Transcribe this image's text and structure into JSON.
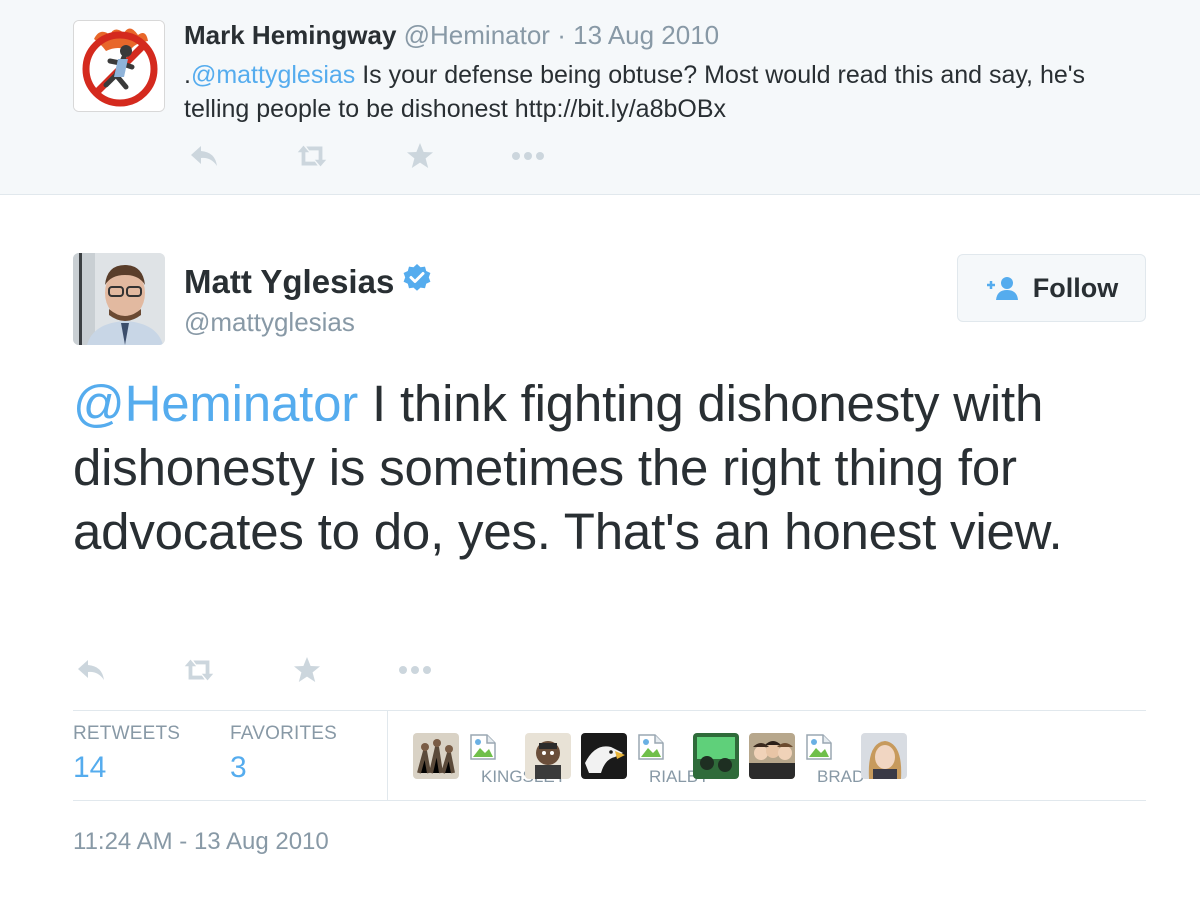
{
  "parent_tweet": {
    "name": "Mark Hemingway",
    "handle": "@Heminator",
    "separator": "·",
    "date": "13 Aug 2010",
    "text_prefix": ".",
    "mention": "@mattyglesias",
    "text_body": " Is your defense being obtuse? Most would read this and say, he's telling people to be dishonest http://bit.ly/a8bOBx",
    "actions": [
      "reply-icon",
      "retweet-icon",
      "favorite-icon",
      "more-icon"
    ]
  },
  "main_tweet": {
    "name": "Matt Yglesias",
    "verified": true,
    "handle": "@mattyglesias",
    "follow_label": "Follow",
    "mention": "@Heminator",
    "text_body": " I think fighting dishonesty with dishonesty is sometimes the right thing for advocates to do, yes. That's an honest view.",
    "actions": [
      "reply-icon",
      "retweet-icon",
      "favorite-icon",
      "more-icon"
    ],
    "stats": {
      "retweets_label": "RETWEETS",
      "retweets_value": "14",
      "favorites_label": "FAVORITES",
      "favorites_value": "3"
    },
    "favoriter_alt_labels": [
      "KINGSLEY",
      "RIALBY",
      "BRAD"
    ],
    "timestamp": "11:24 AM - 13 Aug 2010"
  },
  "colors": {
    "link": "#55acee",
    "muted": "#8899a6",
    "text": "#292f33",
    "parent_bg": "#f5f8fa",
    "icon": "#ccd6dd"
  }
}
